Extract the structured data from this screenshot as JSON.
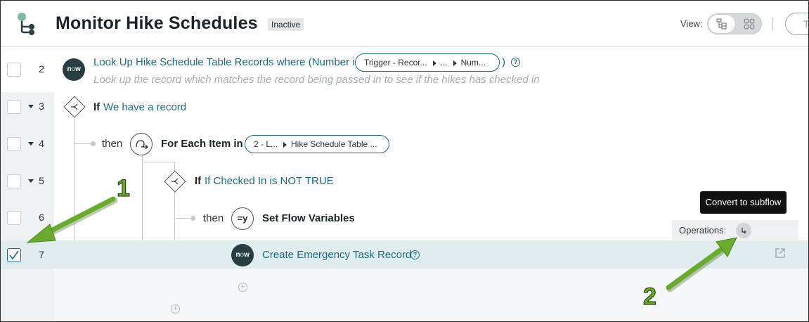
{
  "header": {
    "title": "Monitor Hike Schedules",
    "status": "Inactive",
    "view_label": "View:",
    "partial_button_text": "T"
  },
  "rows": [
    {
      "number": "2",
      "checked": false
    },
    {
      "number": "3",
      "checked": false
    },
    {
      "number": "4",
      "checked": false
    },
    {
      "number": "5",
      "checked": false
    },
    {
      "number": "6",
      "checked": false
    },
    {
      "number": "7",
      "checked": true
    }
  ],
  "steps": {
    "lookup": {
      "badge": "now",
      "text": "Look Up Hike Schedule Table Records where (Number is",
      "pill_parts": [
        "Trigger - Recor...",
        "...",
        "Num..."
      ],
      "close_paren": ")",
      "description": "Look up the record which matches the record being passed in to see if the hikes has checked in"
    },
    "if1": {
      "keyword": "If",
      "condition": "We have a record"
    },
    "foreach": {
      "then": "then",
      "label": "For Each Item in",
      "pill_parts": [
        "2 - L...",
        "Hike Schedule Table ..."
      ]
    },
    "if2": {
      "keyword": "If",
      "condition": "If Checked In is NOT TRUE"
    },
    "setvars": {
      "then": "then",
      "icon_text": "=y",
      "label": "Set Flow Variables"
    },
    "create": {
      "badge": "now",
      "label": "Create Emergency Task Record"
    }
  },
  "operations": {
    "label": "Operations:",
    "tooltip": "Convert to subflow"
  },
  "callouts": [
    "1",
    "2"
  ],
  "colors": {
    "accent": "#1d6a83",
    "callout_green": "#6aaa2e",
    "selected_row": "#e1ecef"
  }
}
